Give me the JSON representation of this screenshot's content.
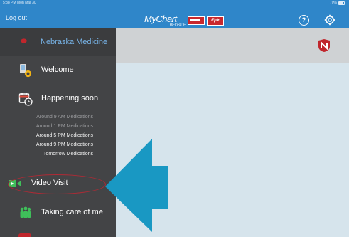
{
  "status_bar": {
    "time_date": "5:38 PM  Mon Mar 30",
    "battery": "70%"
  },
  "top_bar": {
    "logout_label": "Log out",
    "brand_name": "MyChart",
    "brand_sub": "BEDSIDE",
    "powered_by": "powered by",
    "epic": "Epic",
    "help_symbol": "?"
  },
  "sidebar": {
    "organization": "Nebraska Medicine",
    "items": [
      {
        "label": "Welcome"
      },
      {
        "label": "Happening soon"
      },
      {
        "label": "Video Visit"
      },
      {
        "label": "Taking care of me"
      }
    ],
    "appointments": [
      {
        "text": "Around 9 AM  Medications",
        "state": "dim"
      },
      {
        "text": "Around 1 PM  Medications",
        "state": "dim"
      },
      {
        "text": "Around 5 PM  Medications",
        "state": "bright"
      },
      {
        "text": "Around 9 PM  Medications",
        "state": "bright"
      },
      {
        "text": "Tomorrow  Medications",
        "state": "bright"
      }
    ]
  },
  "colors": {
    "top_bar": "#2f86c9",
    "sidebar": "#434446",
    "organization_text": "#78b4e8",
    "arrow": "#1998c3",
    "highlight_ellipse": "#b02a35"
  }
}
